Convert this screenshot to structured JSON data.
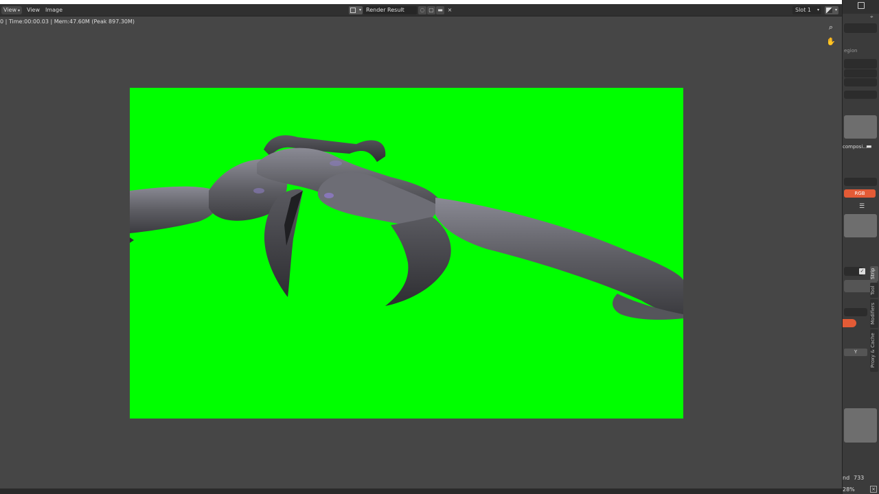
{
  "header": {
    "view_menu": "View",
    "view_menu_2": "View",
    "image_menu": "Image",
    "image_name": "Render Result",
    "close_glyph": "×",
    "slot_label": "Slot 1"
  },
  "viewport": {
    "render_stats": "0 | Time:00:00.03 | Mem:47.60M (Peak 897.30M)",
    "render_background_color": "#00ff00"
  },
  "right_panel": {
    "region_label": "egion",
    "composite_label": "composi...",
    "rgb_label": "RGB",
    "y_label": "Y",
    "end_label": "nd",
    "end_value": "733",
    "zoom_percent": "28%",
    "tabs": {
      "strip": "Strip",
      "tool": "Tool",
      "modifiers": "Modifiers",
      "proxy": "Proxy & Cache"
    }
  },
  "icons": {
    "zoom": "zoom-icon",
    "pan": "hand-icon",
    "folder": "folder-icon",
    "new": "new-image-icon",
    "shield": "fake-user-icon"
  }
}
